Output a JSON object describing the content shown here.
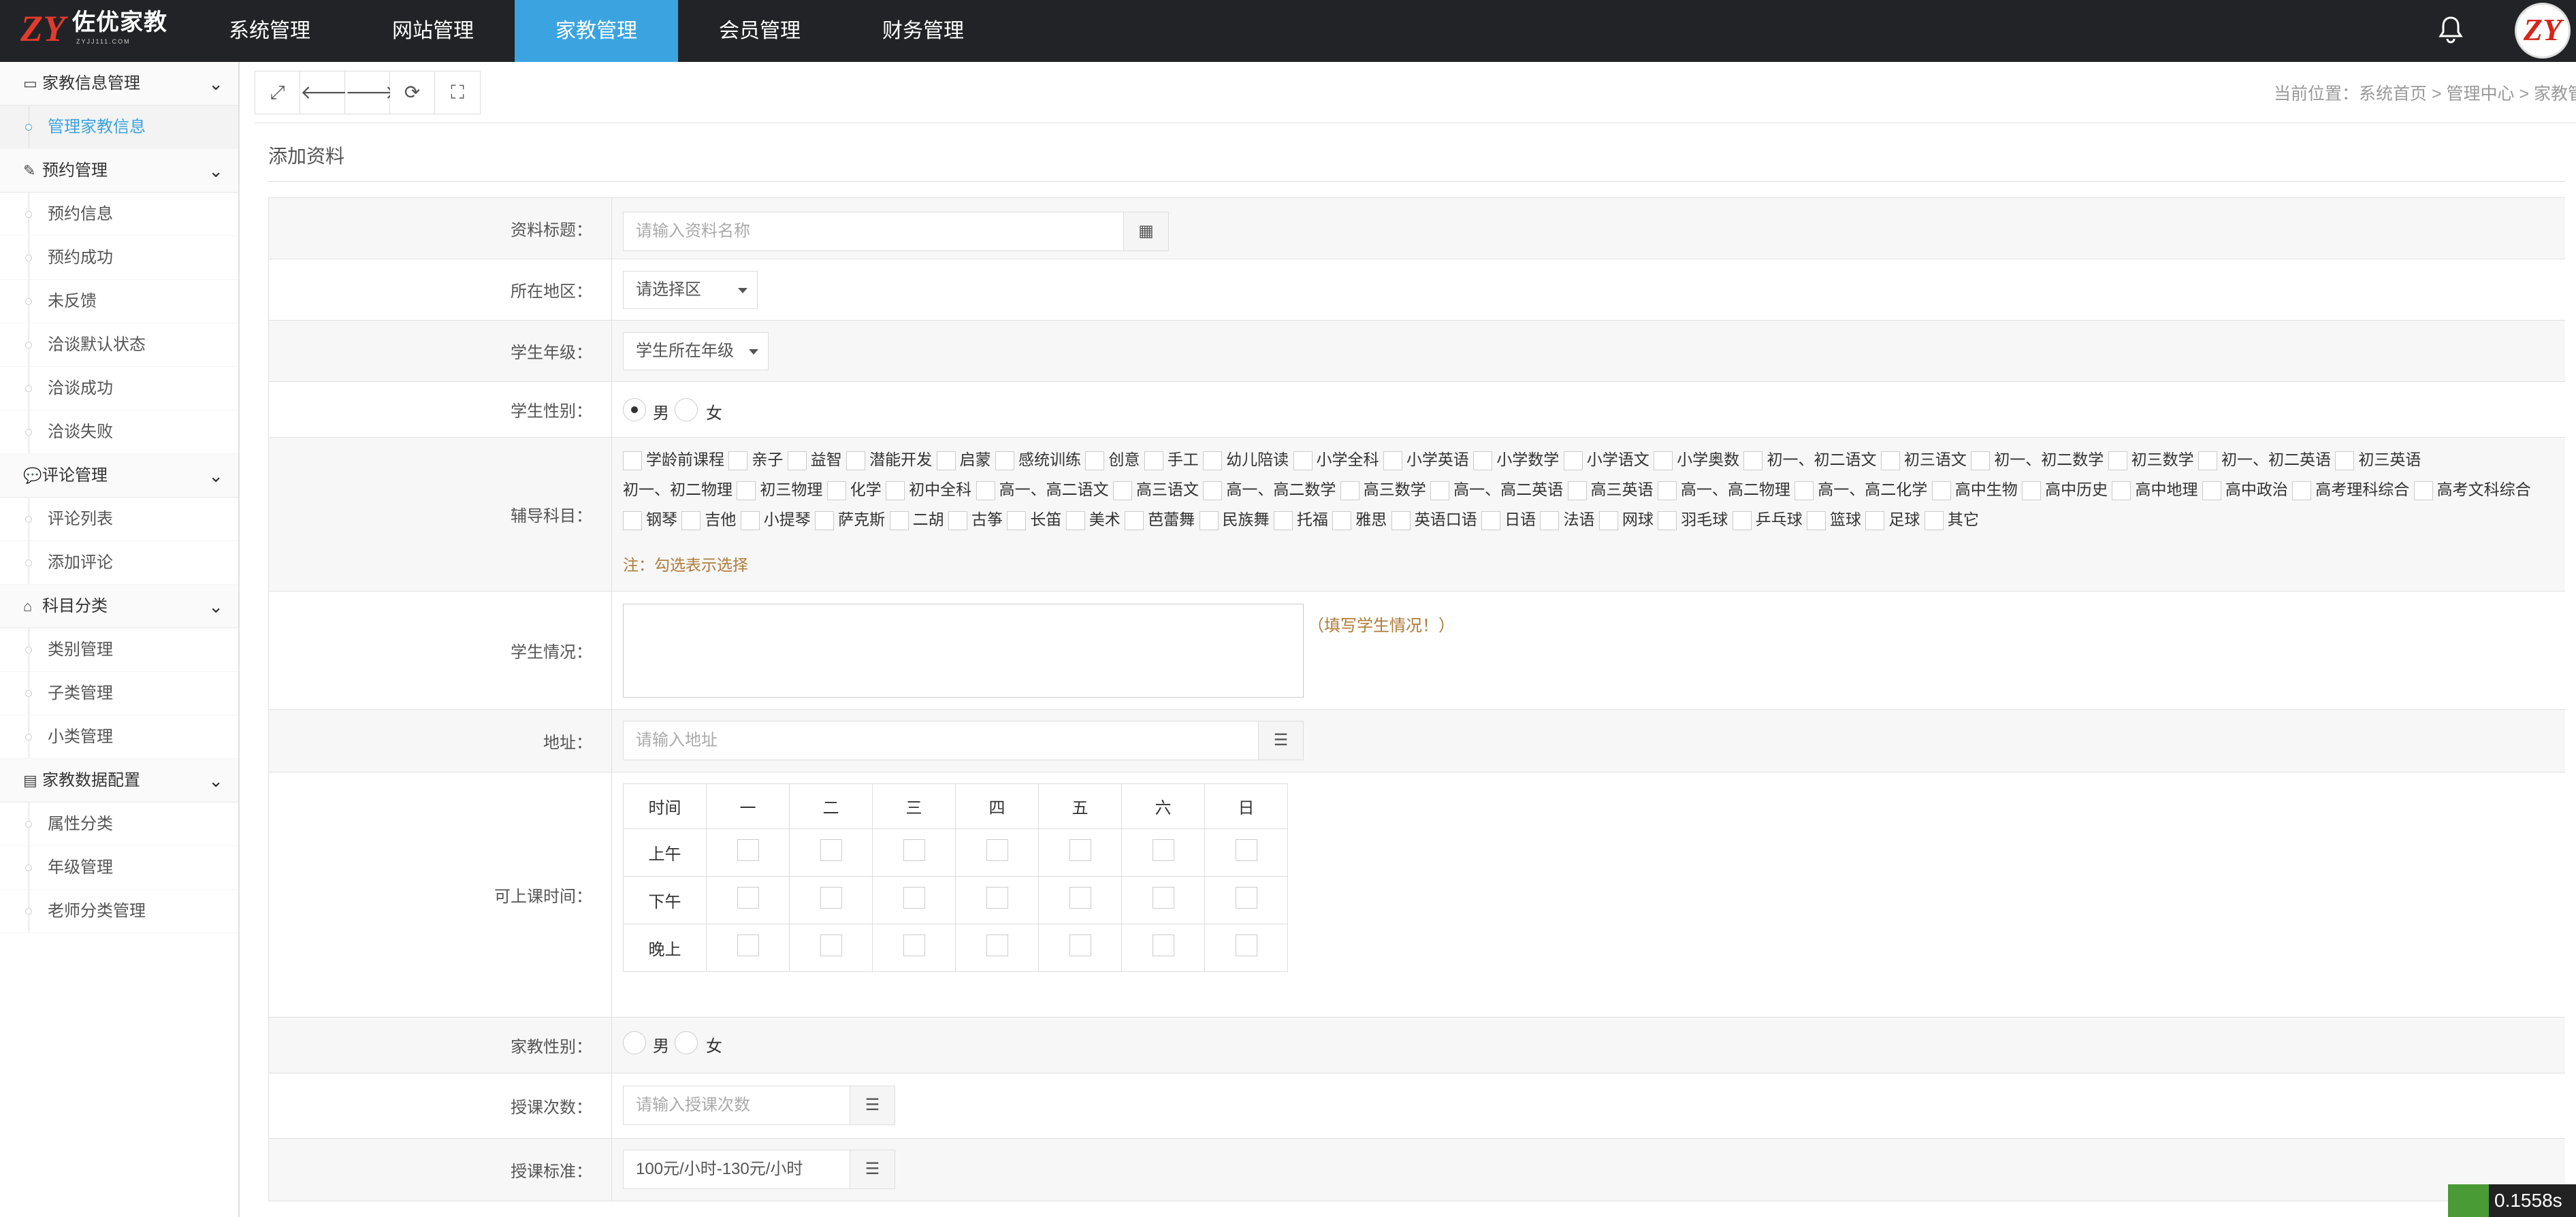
{
  "brand": {
    "name": "佐优家教",
    "sub": "ZYJJ111.COM",
    "mark": "ZY"
  },
  "nav": [
    "系统管理",
    "网站管理",
    "家教管理",
    "会员管理",
    "财务管理"
  ],
  "nav_active": 2,
  "sidebar": {
    "groups": [
      {
        "label": "家教信息管理",
        "icon": "card-icon",
        "items": [
          "管理家教信息"
        ],
        "active": 0
      },
      {
        "label": "预约管理",
        "icon": "pencil-icon",
        "items": [
          "预约信息",
          "预约成功",
          "未反馈",
          "洽谈默认状态",
          "洽谈成功",
          "洽谈失败"
        ]
      },
      {
        "label": "评论管理",
        "icon": "comment-icon",
        "items": [
          "评论列表",
          "添加评论"
        ]
      },
      {
        "label": "科目分类",
        "icon": "basket-icon",
        "items": [
          "类别管理",
          "子类管理",
          "小类管理"
        ]
      },
      {
        "label": "家教数据配置",
        "icon": "list-icon",
        "items": [
          "属性分类",
          "年级管理",
          "老师分类管理"
        ]
      }
    ]
  },
  "toolbar_icons": [
    "expand-icon",
    "back-icon",
    "forward-icon",
    "refresh-icon",
    "fullscreen-icon"
  ],
  "breadcrumb": "当前位置：系统首页 > 管理中心 > 家教管",
  "page_title": "添加资料",
  "form": {
    "title_label": "资料标题：",
    "title_placeholder": "请输入资料名称",
    "region_label": "所在地区：",
    "region_value": "请选择区",
    "grade_label": "学生年级：",
    "grade_value": "学生所在年级",
    "gender_label": "学生性别：",
    "gender_male": "男",
    "gender_female": "女",
    "subject_label": "辅导科目：",
    "subjects_rows": [
      [
        "学龄前课程",
        "亲子",
        "益智",
        "潜能开发",
        "启蒙",
        "感统训练",
        "创意",
        "手工",
        "幼儿陪读",
        "小学全科",
        "小学英语",
        "小学数学",
        "小学语文",
        "小学奥数",
        "初一、初二语文",
        "初三语文",
        "初一、初二数学",
        "初三数学",
        "初一、初二英语",
        "初三英语"
      ],
      [
        "初一、初二物理",
        "初三物理",
        "化学",
        "初中全科",
        "高一、高二语文",
        "高三语文",
        "高一、高二数学",
        "高三数学",
        "高一、高二英语",
        "高三英语",
        "高一、高二物理",
        "高一、高二化学",
        "高中生物",
        "高中历史",
        "高中地理",
        "高中政治",
        "高考理科综合",
        "高考文科综合"
      ],
      [
        "钢琴",
        "吉他",
        "小提琴",
        "萨克斯",
        "二胡",
        "古筝",
        "长笛",
        "美术",
        "芭蕾舞",
        "民族舞",
        "托福",
        "雅思",
        "英语口语",
        "日语",
        "法语",
        "网球",
        "羽毛球",
        "乒乓球",
        "篮球",
        "足球",
        "其它"
      ]
    ],
    "subject_note": "注：勾选表示选择",
    "situation_label": "学生情况：",
    "situation_tip": "（填写学生情况！）",
    "address_label": "地址：",
    "address_placeholder": "请输入地址",
    "time_label": "可上课时间：",
    "time_header": [
      "时间",
      "一",
      "二",
      "三",
      "四",
      "五",
      "六",
      "日"
    ],
    "time_rows": [
      "上午",
      "下午",
      "晚上"
    ],
    "tutor_gender_label": "家教性别：",
    "count_label": "授课次数：",
    "count_placeholder": "请输入授课次数",
    "fee_label": "授课标准：",
    "fee_value": "100元/小时-130元/小时"
  },
  "timer": "0.1558s"
}
